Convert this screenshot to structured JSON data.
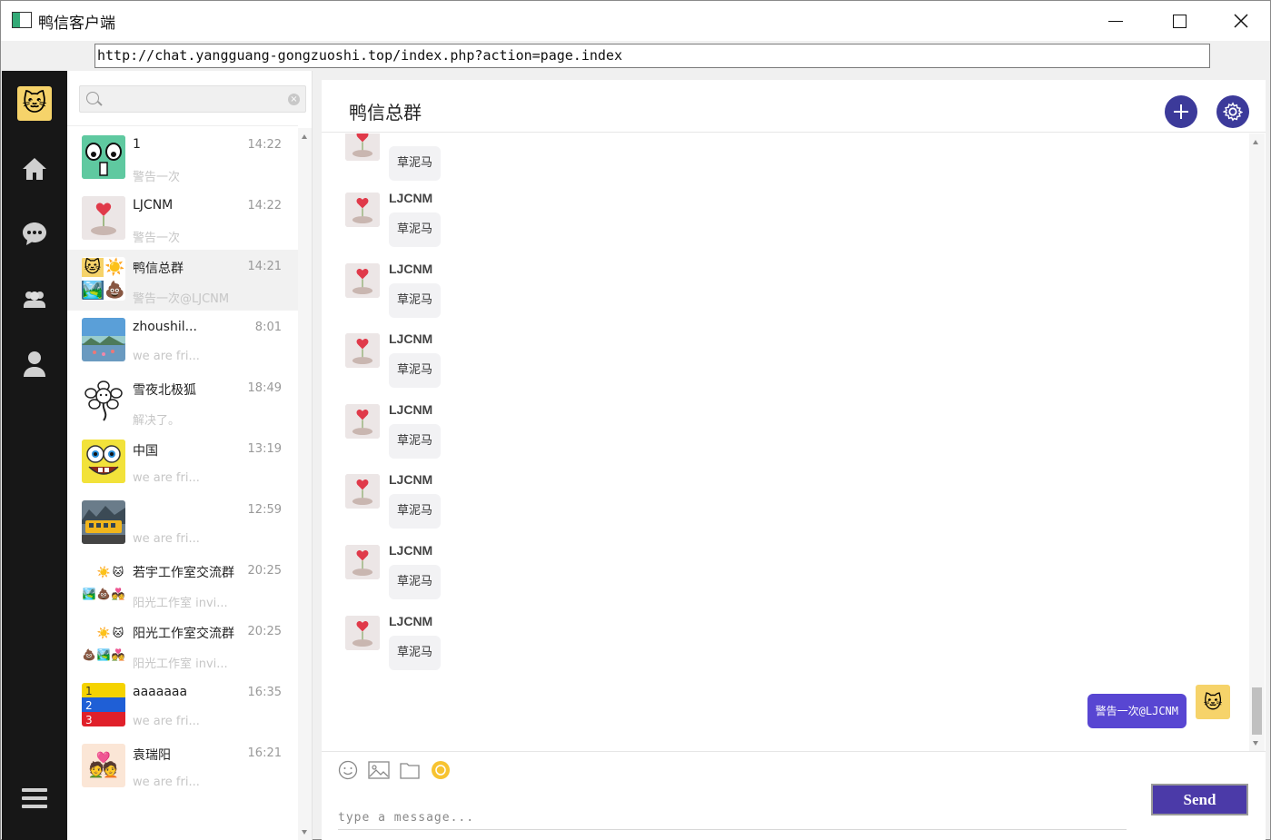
{
  "window": {
    "title": "鸭信客户端",
    "url": "http://chat.yangguang-gongzuoshi.top/index.php?action=page.index"
  },
  "search": {
    "placeholder": ""
  },
  "conversations": [
    {
      "name": "1",
      "time": "14:22",
      "preview": "警告一次"
    },
    {
      "name": "LJCNM",
      "time": "14:22",
      "preview": "警告一次"
    },
    {
      "name": "鸭信总群",
      "time": "14:21",
      "preview": "警告一次@LJCNM"
    },
    {
      "name": "zhoushil...",
      "time": "8:01",
      "preview": "we are fri..."
    },
    {
      "name": "雪夜北极狐",
      "time": "18:49",
      "preview": "解决了。"
    },
    {
      "name": "中国",
      "time": "13:19",
      "preview": "we are fri..."
    },
    {
      "name": "",
      "time": "12:59",
      "preview": "we are fri..."
    },
    {
      "name": "若宇工作室交流群",
      "time": "20:25",
      "preview": "阳光工作室 invi..."
    },
    {
      "name": "阳光工作室交流群",
      "time": "20:25",
      "preview": "阳光工作室 invi..."
    },
    {
      "name": "aaaaaaa",
      "time": "16:35",
      "preview": "we are fri..."
    },
    {
      "name": "袁瑞阳",
      "time": "16:21",
      "preview": "we are fri..."
    }
  ],
  "chat": {
    "title": "鸭信总群",
    "messages": [
      {
        "sender": "",
        "text": "草泥马"
      },
      {
        "sender": "LJCNM",
        "text": "草泥马"
      },
      {
        "sender": "LJCNM",
        "text": "草泥马"
      },
      {
        "sender": "LJCNM",
        "text": "草泥马"
      },
      {
        "sender": "LJCNM",
        "text": "草泥马"
      },
      {
        "sender": "LJCNM",
        "text": "草泥马"
      },
      {
        "sender": "LJCNM",
        "text": "草泥马"
      },
      {
        "sender": "LJCNM",
        "text": "草泥马"
      }
    ],
    "my_message": "警告一次@LJCNM"
  },
  "composer": {
    "placeholder": "type a message...",
    "send_label": "Send"
  },
  "colors": {
    "accent": "#3c3a9a",
    "my_bubble": "#5846d2",
    "nav_bg": "#171717"
  }
}
